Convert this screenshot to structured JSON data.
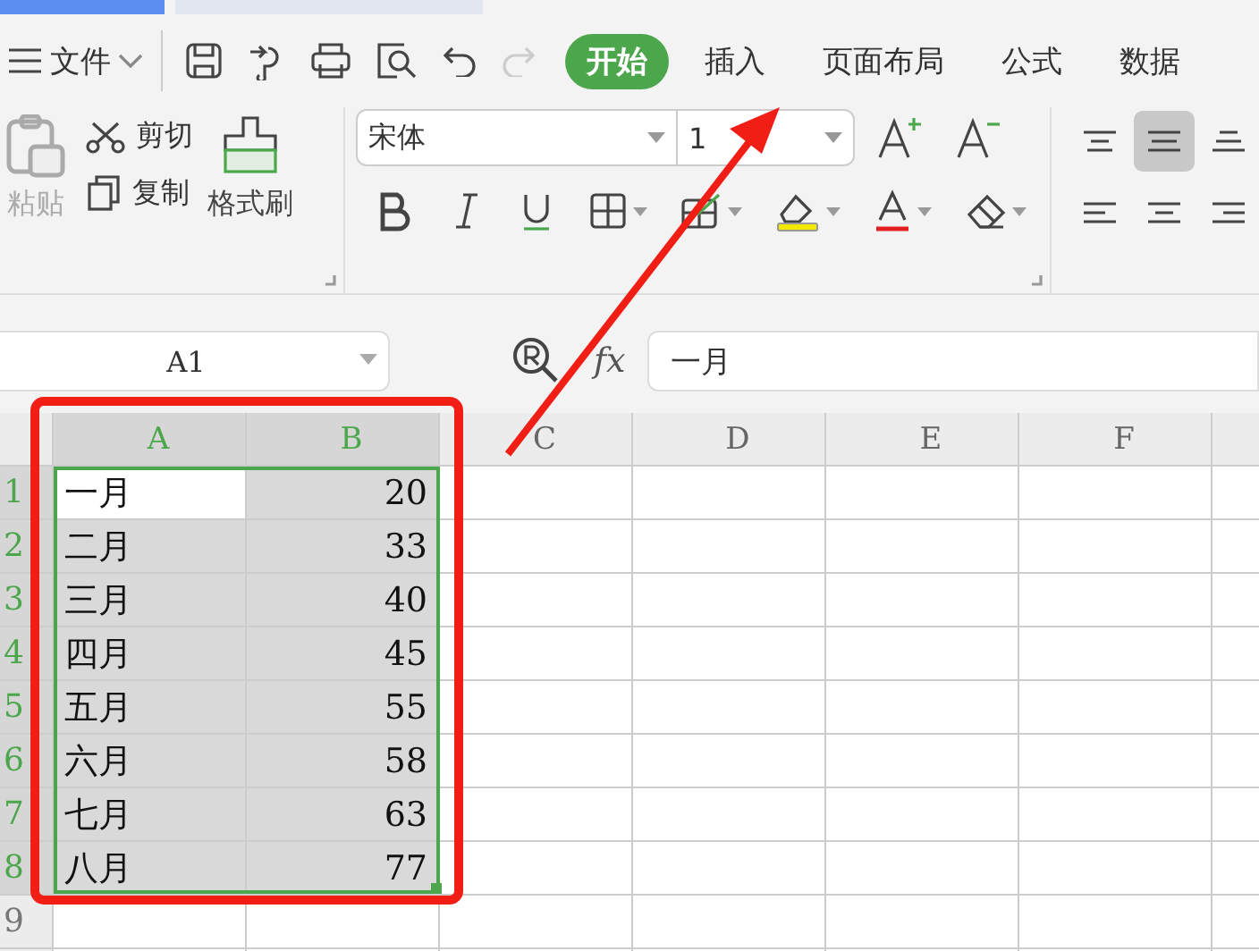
{
  "menu_bar": {
    "file_menu": "文件",
    "tabs": [
      {
        "label": "开始",
        "selected": true
      },
      {
        "label": "插入",
        "selected": false
      },
      {
        "label": "页面布局",
        "selected": false
      },
      {
        "label": "公式",
        "selected": false
      },
      {
        "label": "数据",
        "selected": false
      }
    ]
  },
  "ribbon": {
    "clipboard": {
      "paste": {
        "label": "粘贴",
        "disabled": true
      },
      "cut": "剪切",
      "copy": "复制",
      "format_painter": "格式刷"
    },
    "font": {
      "name": "宋体",
      "size": "1"
    },
    "alignment": [
      {
        "kind": "top",
        "selected": false
      },
      {
        "kind": "middle",
        "selected": true
      },
      {
        "kind": "bottom",
        "selected": false
      },
      {
        "kind": "left",
        "selected": false
      },
      {
        "kind": "center",
        "selected": false
      },
      {
        "kind": "right",
        "selected": false
      }
    ]
  },
  "formula_bar": {
    "name_box": "A1",
    "fx": "fx",
    "formula": "一月"
  },
  "sheet": {
    "columns": [
      {
        "label": "A",
        "selected": true
      },
      {
        "label": "B",
        "selected": true
      },
      {
        "label": "C",
        "selected": false
      },
      {
        "label": "D",
        "selected": false
      },
      {
        "label": "E",
        "selected": false
      },
      {
        "label": "F",
        "selected": false
      }
    ],
    "rows": [
      {
        "number": "1",
        "selected": true,
        "cells": [
          {
            "kind": "text",
            "text": "一月",
            "selected": true,
            "active": true
          },
          {
            "kind": "number",
            "text": "20",
            "selected": true,
            "active": false
          }
        ]
      },
      {
        "number": "2",
        "selected": true,
        "cells": [
          {
            "kind": "text",
            "text": "二月",
            "selected": true,
            "active": false
          },
          {
            "kind": "number",
            "text": "33",
            "selected": true,
            "active": false
          }
        ]
      },
      {
        "number": "3",
        "selected": true,
        "cells": [
          {
            "kind": "text",
            "text": "三月",
            "selected": true,
            "active": false
          },
          {
            "kind": "number",
            "text": "40",
            "selected": true,
            "active": false
          }
        ]
      },
      {
        "number": "4",
        "selected": true,
        "cells": [
          {
            "kind": "text",
            "text": "四月",
            "selected": true,
            "active": false
          },
          {
            "kind": "number",
            "text": "45",
            "selected": true,
            "active": false
          }
        ]
      },
      {
        "number": "5",
        "selected": true,
        "cells": [
          {
            "kind": "text",
            "text": "五月",
            "selected": true,
            "active": false
          },
          {
            "kind": "number",
            "text": "55",
            "selected": true,
            "active": false
          }
        ]
      },
      {
        "number": "6",
        "selected": true,
        "cells": [
          {
            "kind": "text",
            "text": "六月",
            "selected": true,
            "active": false
          },
          {
            "kind": "number",
            "text": "58",
            "selected": true,
            "active": false
          }
        ]
      },
      {
        "number": "7",
        "selected": true,
        "cells": [
          {
            "kind": "text",
            "text": "七月",
            "selected": true,
            "active": false
          },
          {
            "kind": "number",
            "text": "63",
            "selected": true,
            "active": false
          }
        ]
      },
      {
        "number": "8",
        "selected": true,
        "cells": [
          {
            "kind": "text",
            "text": "八月",
            "selected": true,
            "active": false
          },
          {
            "kind": "number",
            "text": "77",
            "selected": true,
            "active": false
          }
        ]
      },
      {
        "number": "9",
        "selected": false,
        "cells": []
      }
    ]
  }
}
